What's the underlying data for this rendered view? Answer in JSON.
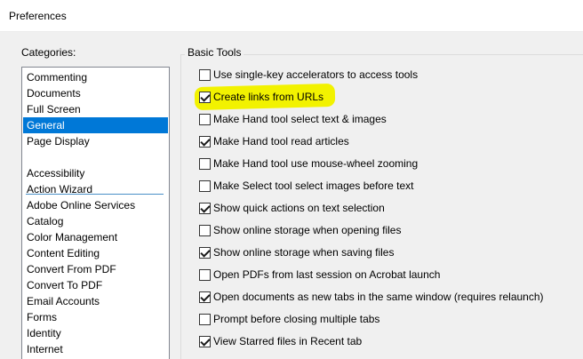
{
  "window": {
    "title": "Preferences"
  },
  "categories": {
    "label": "Categories:",
    "top_items": [
      "Commenting",
      "Documents",
      "Full Screen",
      "General",
      "Page Display"
    ],
    "selected": "General",
    "other_items": [
      "Accessibility",
      "Action Wizard",
      "Adobe Online Services",
      "Catalog",
      "Color Management",
      "Content Editing",
      "Convert From PDF",
      "Convert To PDF",
      "Email Accounts",
      "Forms",
      "Identity",
      "Internet"
    ]
  },
  "basic_tools": {
    "label": "Basic Tools",
    "options": [
      {
        "label": "Use single-key accelerators to access tools",
        "checked": false
      },
      {
        "label": "Create links from URLs",
        "checked": true
      },
      {
        "label": "Make Hand tool select text & images",
        "checked": false
      },
      {
        "label": "Make Hand tool read articles",
        "checked": true
      },
      {
        "label": "Make Hand tool use mouse-wheel zooming",
        "checked": false
      },
      {
        "label": "Make Select tool select images before text",
        "checked": false
      },
      {
        "label": "Show quick actions on text selection",
        "checked": true
      },
      {
        "label": "Show online storage when opening files",
        "checked": false
      },
      {
        "label": "Show online storage when saving files",
        "checked": true
      },
      {
        "label": "Open PDFs from last session on Acrobat launch",
        "checked": false
      },
      {
        "label": "Open documents as new tabs in the same window (requires relaunch)",
        "checked": true
      },
      {
        "label": "Prompt before closing multiple tabs",
        "checked": false
      },
      {
        "label": "View Starred files in Recent tab",
        "checked": true
      }
    ]
  },
  "colors": {
    "selection": "#0078d7",
    "highlight": "#f2f200"
  }
}
